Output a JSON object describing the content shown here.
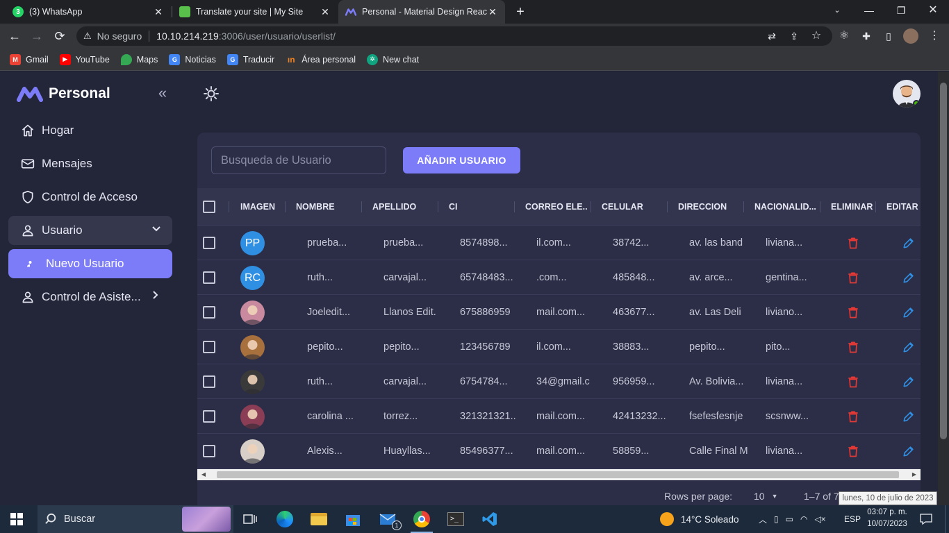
{
  "browser": {
    "tabs": [
      {
        "label": "(3) WhatsApp",
        "icon": "whatsapp-icon",
        "color": "#25d366"
      },
      {
        "label": "Translate your site | My Site",
        "icon": "translate-site-icon",
        "color": "#58c04b"
      },
      {
        "label": "Personal - Material Design React",
        "icon": "material-m-icon",
        "color": "#7c7cf8"
      }
    ],
    "url_warning": "No seguro",
    "url_host": "10.10.214.219",
    "url_path": ":3006/user/usuario/userlist/",
    "bookmarks": [
      {
        "label": "Gmail",
        "icon": "gmail-icon",
        "color": "#ea4335"
      },
      {
        "label": "YouTube",
        "icon": "youtube-icon",
        "color": "#ff0000"
      },
      {
        "label": "Maps",
        "icon": "maps-icon",
        "color": "#34a853"
      },
      {
        "label": "Noticias",
        "icon": "news-icon",
        "color": "#4285f4"
      },
      {
        "label": "Traducir",
        "icon": "translate-icon",
        "color": "#4285f4"
      },
      {
        "label": "Área personal",
        "icon": "area-personal-icon",
        "color": "#f58220"
      },
      {
        "label": "New chat",
        "icon": "openai-icon",
        "color": "#10a37f"
      }
    ]
  },
  "app": {
    "brand": "Personal",
    "accent": "#7c7cf8",
    "nav": [
      {
        "label": "Hogar",
        "icon": "home-icon"
      },
      {
        "label": "Mensajes",
        "icon": "mail-icon"
      },
      {
        "label": "Control de Acceso",
        "icon": "shield-icon"
      },
      {
        "label": "Usuario",
        "icon": "user-icon"
      },
      {
        "label": "Nuevo Usuario",
        "icon": "user-small-icon"
      },
      {
        "label": "Control de Asiste...",
        "icon": "user-icon"
      }
    ],
    "search_placeholder": "Busqueda de Usuario",
    "add_button": "AÑADIR USUARIO",
    "columns": [
      "IMAGEN",
      "NOMBRE",
      "APELLIDO",
      "CI",
      "CORREO ELE...",
      "CELULAR",
      "DIRECCION",
      "NACIONALID...",
      "ELIMINAR",
      "EDITAR"
    ],
    "rows": [
      {
        "avatar": "PP",
        "avatar_color": "#2f8fe3",
        "nombre": "prueba...",
        "apellido": "prueba...",
        "ci": "8574898...",
        "correo": "il.com...",
        "celular": "38742...",
        "direccion": "av. las band",
        "nacionalidad": "liviana..."
      },
      {
        "avatar": "RC",
        "avatar_color": "#2f8fe3",
        "nombre": "ruth...",
        "apellido": "carvajal...",
        "ci": "65748483...",
        "correo": ".com...",
        "celular": "485848...",
        "direccion": "av. arce...",
        "nacionalidad": "gentina..."
      },
      {
        "avatar": "",
        "avatar_color": "#c98aa0",
        "nombre": "Joeledit...",
        "apellido": "Llanos Edit.",
        "ci": "675886959",
        "correo": "mail.com...",
        "celular": "463677...",
        "direccion": "av. Las Deli",
        "nacionalidad": "liviano..."
      },
      {
        "avatar": "",
        "avatar_color": "#a8703d",
        "nombre": "pepito...",
        "apellido": "pepito...",
        "ci": "123456789",
        "correo": "il.com...",
        "celular": "38883...",
        "direccion": "pepito...",
        "nacionalidad": "pito..."
      },
      {
        "avatar": "",
        "avatar_color": "#3a3a3a",
        "nombre": "ruth...",
        "apellido": "carvajal...",
        "ci": "6754784...",
        "correo": "34@gmail.c",
        "celular": "956959...",
        "direccion": "Av. Bolivia...",
        "nacionalidad": "liviana..."
      },
      {
        "avatar": "",
        "avatar_color": "#8a3d55",
        "nombre": "carolina ...",
        "apellido": "torrez...",
        "ci": "321321321...",
        "correo": "mail.com...",
        "celular": "42413232...",
        "direccion": "fsefesfesnje",
        "nacionalidad": "scsnww..."
      },
      {
        "avatar": "",
        "avatar_color": "#d8d0c8",
        "nombre": "Alexis...",
        "apellido": "Huayllas...",
        "ci": "85496377...",
        "correo": "mail.com...",
        "celular": "58859...",
        "direccion": "Calle Final M",
        "nacionalidad": "liviana..."
      }
    ],
    "rows_per_page_label": "Rows per page:",
    "rows_per_page": "10",
    "range": "1–7 of 7",
    "delete_color": "#e53935",
    "edit_color": "#2f8fe3"
  },
  "tooltip": "lunes, 10 de julio de 2023",
  "taskbar": {
    "search": "Buscar",
    "weather": "14°C  Soleado",
    "lang": "ESP",
    "time": "03:07 p. m.",
    "date": "10/07/2023",
    "mail_badge": "1"
  }
}
